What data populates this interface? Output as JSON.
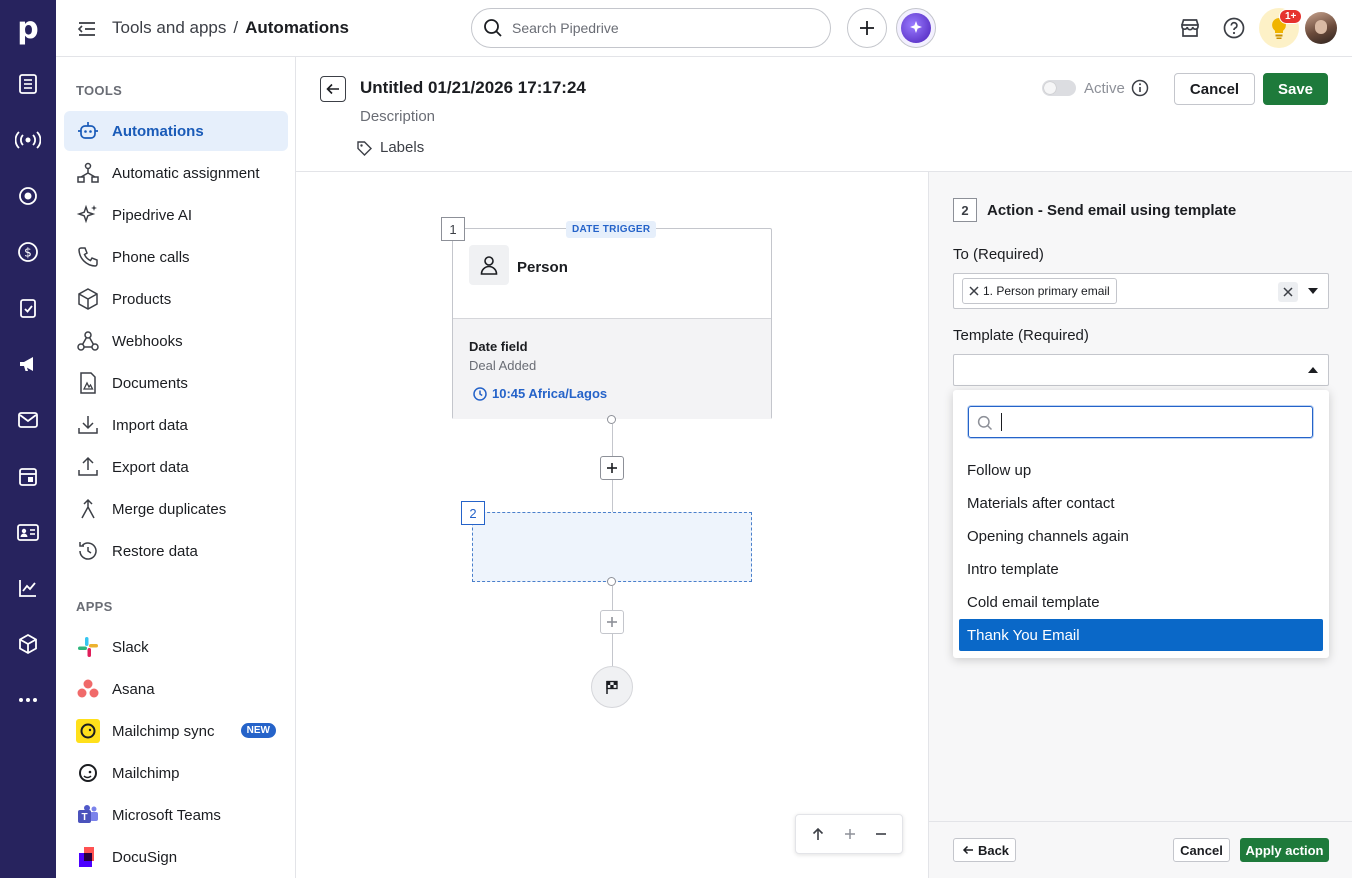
{
  "rail": {
    "logo": "p",
    "icons": [
      "leads-icon",
      "campaigns-signal-icon",
      "target-icon",
      "deals-dollar-icon",
      "tasks-clipboard-icon",
      "megaphone-icon",
      "mail-icon",
      "calendar-icon",
      "contacts-card-icon",
      "insights-chart-icon",
      "products-box-icon",
      "more-dots-icon"
    ]
  },
  "topbar": {
    "breadcrumb_parent": "Tools and apps",
    "breadcrumb_sep": "/",
    "breadcrumb_current": "Automations",
    "search_placeholder": "Search Pipedrive",
    "notification_badge": "1+"
  },
  "sidebar": {
    "tools_heading": "TOOLS",
    "tools": [
      {
        "label": "Automations",
        "icon": "automations-bot-icon",
        "active": true
      },
      {
        "label": "Automatic assignment",
        "icon": "assignment-icon"
      },
      {
        "label": "Pipedrive AI",
        "icon": "sparkle-icon"
      },
      {
        "label": "Phone calls",
        "icon": "phone-icon"
      },
      {
        "label": "Products",
        "icon": "box-icon"
      },
      {
        "label": "Webhooks",
        "icon": "webhook-icon"
      },
      {
        "label": "Documents",
        "icon": "document-icon"
      },
      {
        "label": "Import data",
        "icon": "import-icon"
      },
      {
        "label": "Export data",
        "icon": "export-icon"
      },
      {
        "label": "Merge duplicates",
        "icon": "merge-icon"
      },
      {
        "label": "Restore data",
        "icon": "restore-icon"
      }
    ],
    "apps_heading": "APPS",
    "apps": [
      {
        "label": "Slack",
        "icon": "slack-icon"
      },
      {
        "label": "Asana",
        "icon": "asana-icon"
      },
      {
        "label": "Mailchimp sync",
        "icon": "mailchimp-icon",
        "badge": "NEW"
      },
      {
        "label": "Mailchimp",
        "icon": "mailchimp-icon"
      },
      {
        "label": "Microsoft Teams",
        "icon": "teams-icon"
      },
      {
        "label": "DocuSign",
        "icon": "docusign-icon"
      }
    ]
  },
  "header": {
    "title": "Untitled 01/21/2026 17:17:24",
    "description": "Description",
    "labels": "Labels",
    "active_label": "Active",
    "cancel": "Cancel",
    "save": "Save"
  },
  "canvas": {
    "step1_number": "1",
    "trigger_badge": "DATE TRIGGER",
    "trigger_entity": "Person",
    "trigger_field_title": "Date field",
    "trigger_field_value": "Deal Added",
    "trigger_time": "10:45 Africa/Lagos",
    "step2_number": "2"
  },
  "panel": {
    "step_number": "2",
    "title": "Action - Send email using template",
    "to_label": "To (Required)",
    "to_chip": "1. Person primary email",
    "template_label": "Template (Required)",
    "template_options": [
      "Follow up",
      "Materials after contact",
      "Opening channels again",
      "Intro template",
      "Cold email template",
      "Thank You Email"
    ],
    "selected_option": "Thank You Email",
    "back": "Back",
    "cancel": "Cancel",
    "apply": "Apply action"
  },
  "colors": {
    "rail": "#27235e",
    "accent": "#2563c9",
    "primary_green": "#1e7a3b",
    "selected_option": "#0a68c8"
  }
}
